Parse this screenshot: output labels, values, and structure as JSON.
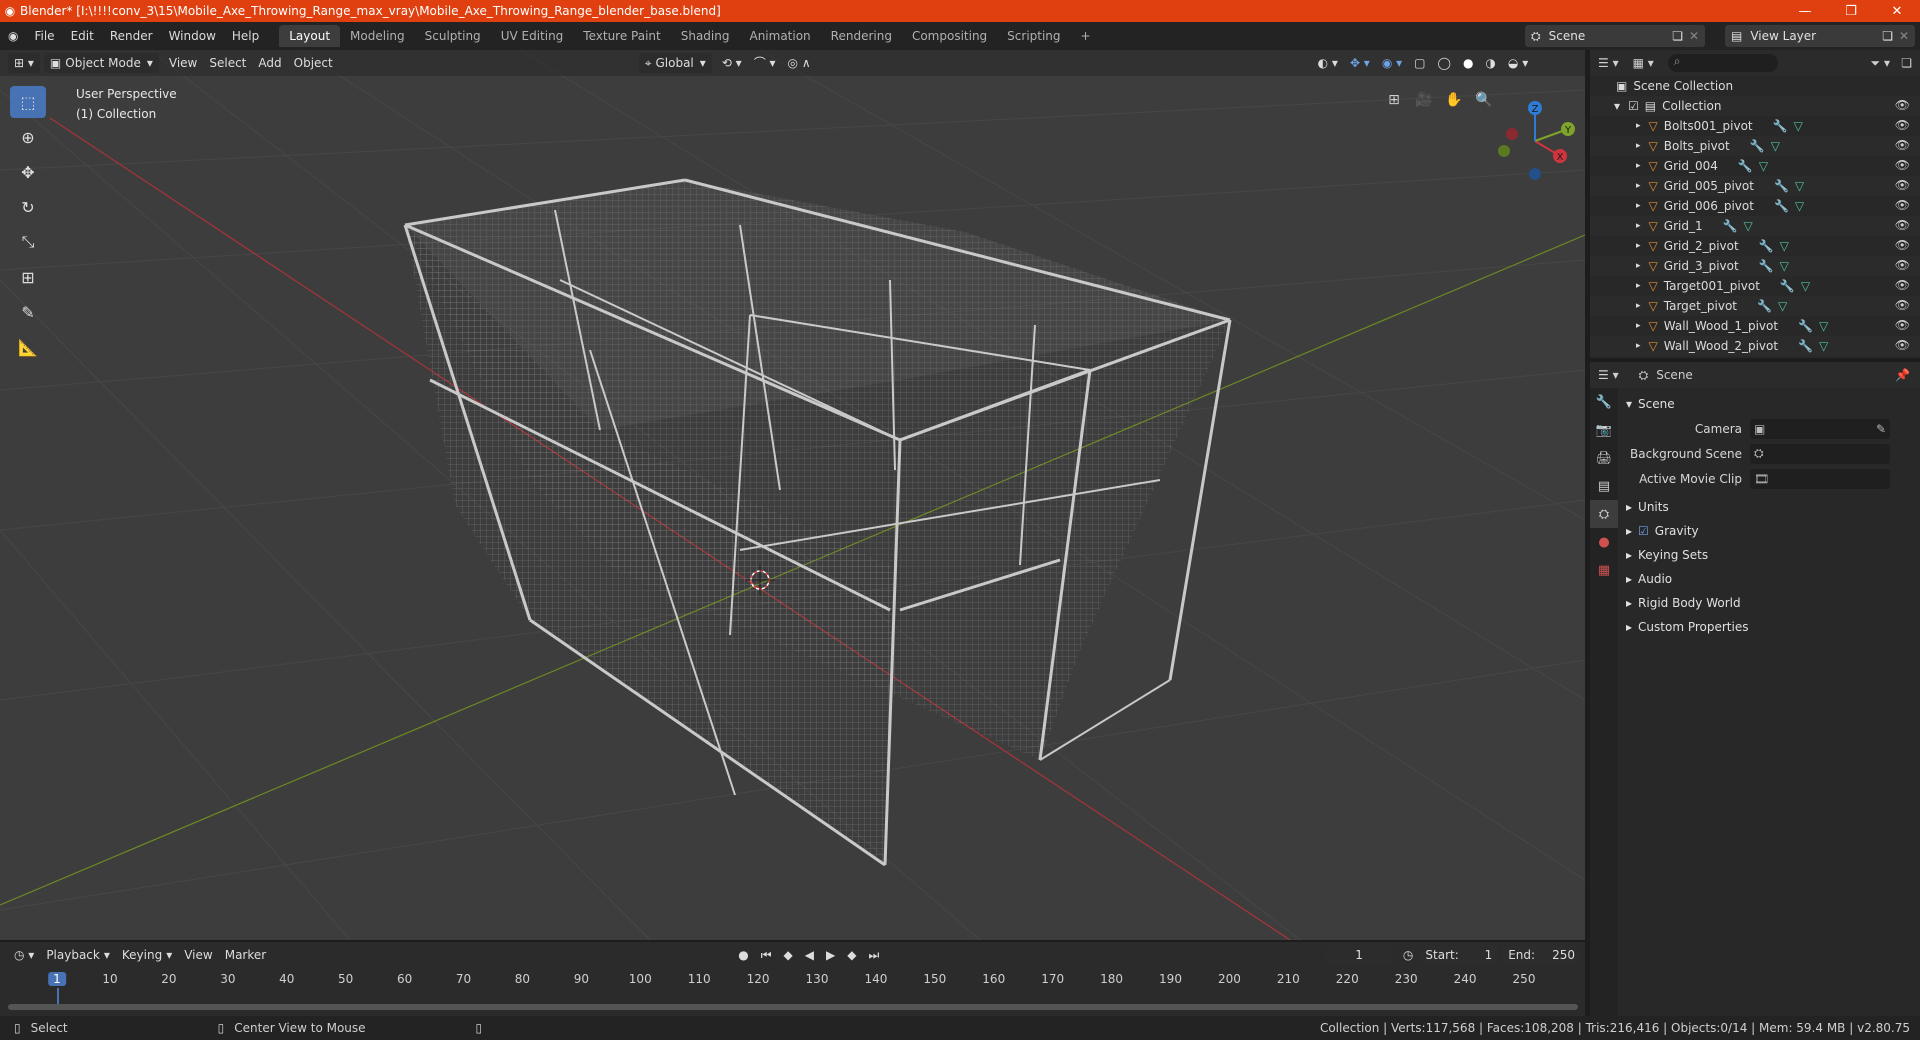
{
  "titlebar": {
    "title": "Blender* [I:\\!!!!conv_3\\15\\Mobile_Axe_Throwing_Range_max_vray\\Mobile_Axe_Throwing_Range_blender_base.blend]"
  },
  "menu": [
    "File",
    "Edit",
    "Render",
    "Window",
    "Help"
  ],
  "workspaces": [
    "Layout",
    "Modeling",
    "Sculpting",
    "UV Editing",
    "Texture Paint",
    "Shading",
    "Animation",
    "Rendering",
    "Compositing",
    "Scripting"
  ],
  "scene_selector": "Scene",
  "view_layer_selector": "View Layer",
  "viewport": {
    "mode": "Object Mode",
    "menus": [
      "View",
      "Select",
      "Add",
      "Object"
    ],
    "transform_orientation": "Global",
    "info_line1": "User Perspective",
    "info_line2": "(1) Collection"
  },
  "gizmo": {
    "x": "X",
    "y": "Y",
    "z": "Z"
  },
  "outliner": {
    "root": "Scene Collection",
    "collection": "Collection",
    "items": [
      "Bolts001_pivot",
      "Bolts_pivot",
      "Grid_004",
      "Grid_005_pivot",
      "Grid_006_pivot",
      "Grid_1",
      "Grid_2_pivot",
      "Grid_3_pivot",
      "Target001_pivot",
      "Target_pivot",
      "Wall_Wood_1_pivot",
      "Wall_Wood_2_pivot"
    ]
  },
  "properties": {
    "header": "Scene",
    "panel_scene": "Scene",
    "camera_label": "Camera",
    "background_scene_label": "Background Scene",
    "active_movie_clip_label": "Active Movie Clip",
    "panels": [
      "Units",
      "Gravity",
      "Keying Sets",
      "Audio",
      "Rigid Body World",
      "Custom Properties"
    ]
  },
  "timeline": {
    "menus": [
      "Playback",
      "Keying",
      "View",
      "Marker"
    ],
    "current_frame": "1",
    "start_label": "Start:",
    "start": "1",
    "end_label": "End:",
    "end": "250",
    "ticks": [
      "1",
      "10",
      "20",
      "30",
      "40",
      "50",
      "60",
      "70",
      "80",
      "90",
      "100",
      "110",
      "120",
      "130",
      "140",
      "150",
      "160",
      "170",
      "180",
      "190",
      "200",
      "210",
      "220",
      "230",
      "240",
      "250"
    ]
  },
  "statusbar": {
    "left": "Select",
    "middle": "Center View to Mouse",
    "right": "Collection | Verts:117,568 | Faces:108,208 | Tris:216,416 | Objects:0/14 | Mem: 59.4 MB | v2.80.75"
  },
  "colors": {
    "accent": "#4772b3",
    "titlebar": "#e0400f",
    "axis_x": "#d0343f",
    "axis_y": "#7fa32b",
    "axis_z": "#2f7bd6"
  }
}
